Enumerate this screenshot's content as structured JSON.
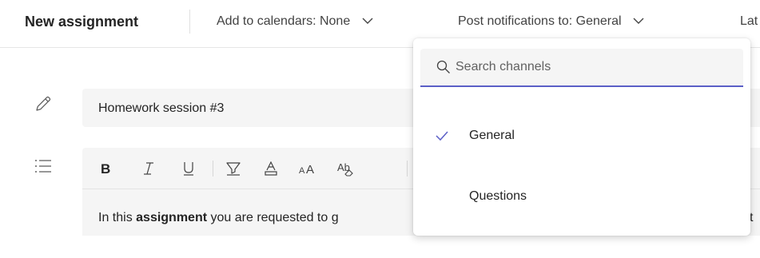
{
  "header": {
    "title": "New assignment",
    "calendar_label": "Add to calendars: None",
    "notifications_label": "Post notifications to: General",
    "late_label_partial": "Lat"
  },
  "assignment": {
    "title_value": "Homework session #3"
  },
  "editor": {
    "text_prefix": "In this ",
    "text_bold": "assignment",
    "text_middle": " you are requested to ",
    "text_underlined": "g",
    "text_after_dropdown": "t"
  },
  "dropdown": {
    "search_placeholder": "Search channels",
    "options": [
      {
        "label": "General",
        "selected": true
      },
      {
        "label": "Questions",
        "selected": false
      }
    ]
  },
  "colors": {
    "accent": "#5b5fc7",
    "text": "#242424",
    "field_bg": "#f5f5f5"
  },
  "icons": {
    "title_field": "pencil-icon",
    "instructions_field": "list-icon",
    "search": "search-icon",
    "selected": "checkmark-icon",
    "dropdown": "chevron-down-icon"
  }
}
